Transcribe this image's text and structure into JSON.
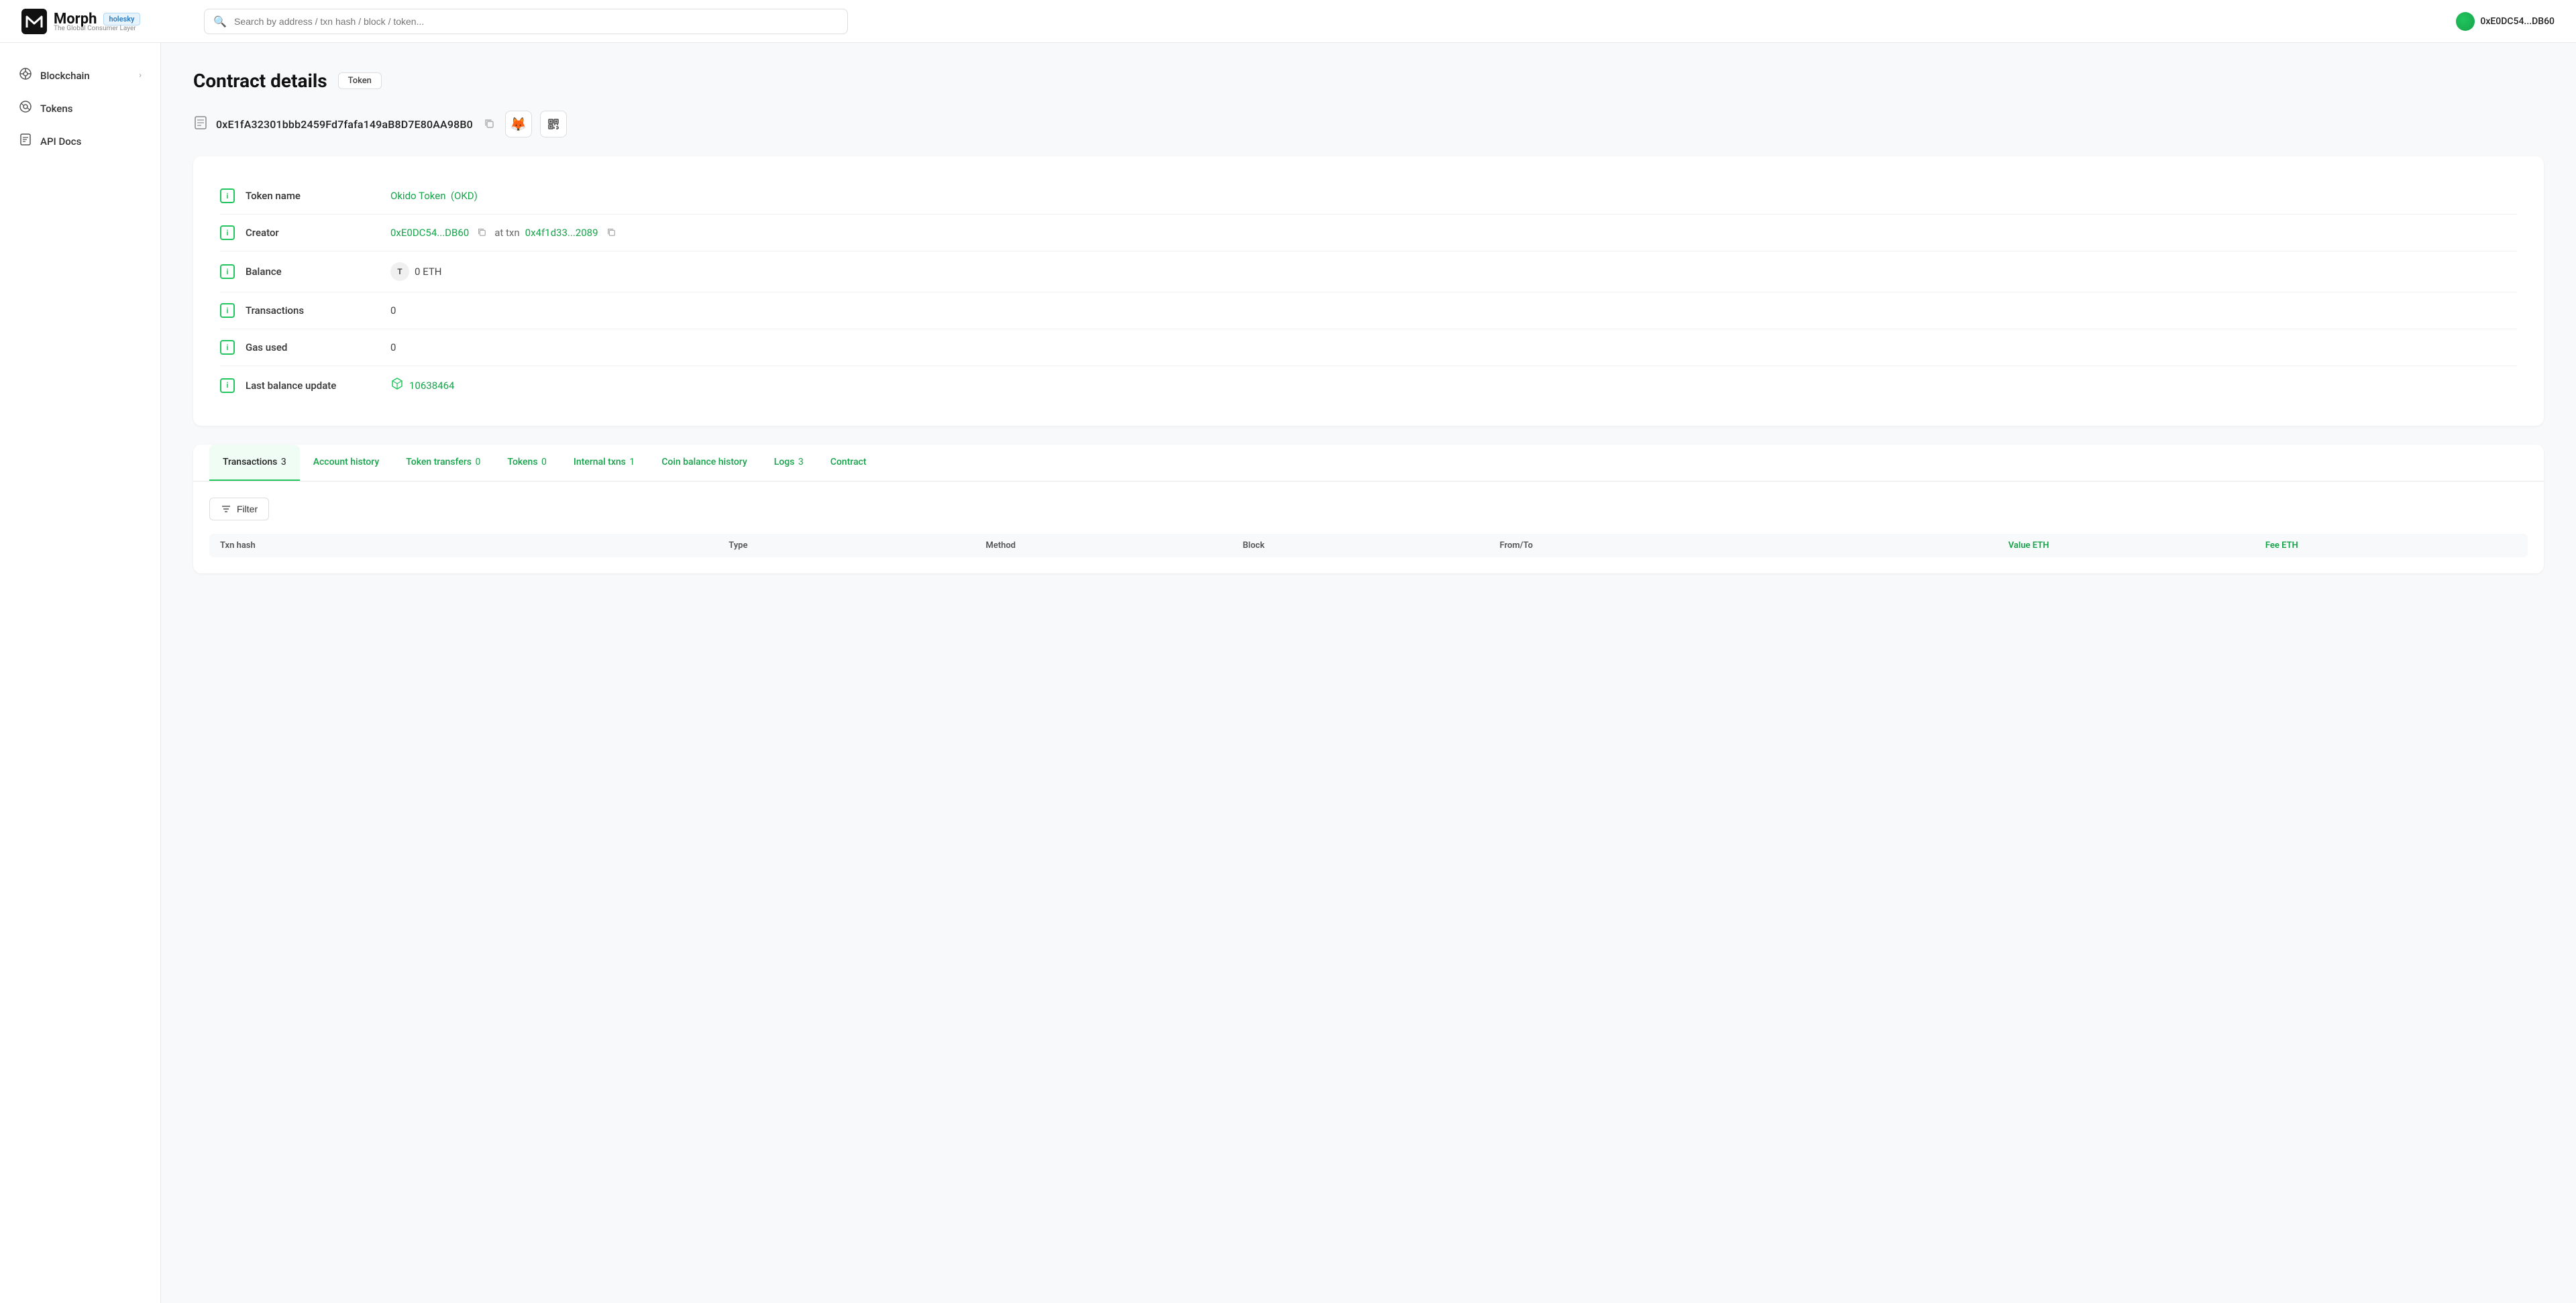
{
  "topbar": {
    "logo_text": "Morph",
    "logo_badge": "holesky",
    "logo_sub": "The Global Consumer Layer",
    "search_placeholder": "Search by address / txn hash / block / token...",
    "wallet_address": "0xE0DC54...DB60"
  },
  "sidebar": {
    "items": [
      {
        "id": "blockchain",
        "label": "Blockchain",
        "icon": "⚙",
        "has_chevron": true
      },
      {
        "id": "tokens",
        "label": "Tokens",
        "icon": "👁",
        "has_chevron": false
      },
      {
        "id": "api-docs",
        "label": "API Docs",
        "icon": "⌨",
        "has_chevron": false
      }
    ]
  },
  "page": {
    "title": "Contract details",
    "badge": "Token",
    "address": "0xE1fA32301bbb2459Fd7fafa149aB8D7E80AA98B0"
  },
  "contract_details": {
    "rows": [
      {
        "id": "token-name",
        "label": "Token name",
        "value": "Okido Token  (OKD)",
        "type": "green"
      },
      {
        "id": "creator",
        "label": "Creator",
        "value_parts": [
          {
            "text": "0xE0DC54...DB60",
            "type": "green",
            "copyable": true
          },
          {
            "text": " at txn ",
            "type": "normal"
          },
          {
            "text": "0x4f1d33...2089",
            "type": "green",
            "copyable": true
          }
        ]
      },
      {
        "id": "balance",
        "label": "Balance",
        "value": "0 ETH",
        "has_token_icon": true
      },
      {
        "id": "transactions",
        "label": "Transactions",
        "value": "0"
      },
      {
        "id": "gas-used",
        "label": "Gas used",
        "value": "0"
      },
      {
        "id": "last-balance-update",
        "label": "Last balance update",
        "value": "10638464",
        "type": "green_block"
      }
    ]
  },
  "tabs": {
    "items": [
      {
        "id": "transactions",
        "label": "Transactions",
        "count": "3",
        "active": true
      },
      {
        "id": "account-history",
        "label": "Account history",
        "count": "",
        "active": false
      },
      {
        "id": "token-transfers",
        "label": "Token transfers",
        "count": "0",
        "active": false
      },
      {
        "id": "tokens",
        "label": "Tokens",
        "count": "0",
        "active": false
      },
      {
        "id": "internal-txns",
        "label": "Internal txns",
        "count": "1",
        "active": false
      },
      {
        "id": "coin-balance-history",
        "label": "Coin balance history",
        "count": "",
        "active": false
      },
      {
        "id": "logs",
        "label": "Logs",
        "count": "3",
        "active": false
      },
      {
        "id": "contract",
        "label": "Contract",
        "count": "",
        "active": false
      }
    ]
  },
  "filter": {
    "label": "Filter"
  },
  "table": {
    "columns": [
      {
        "id": "txn-hash",
        "label": "Txn hash"
      },
      {
        "id": "type",
        "label": "Type"
      },
      {
        "id": "method",
        "label": "Method"
      },
      {
        "id": "block",
        "label": "Block"
      },
      {
        "id": "from-to",
        "label": "From/To"
      },
      {
        "id": "value-eth",
        "label": "Value ETH",
        "green": true
      },
      {
        "id": "fee-eth",
        "label": "Fee ETH",
        "green": true
      }
    ]
  }
}
